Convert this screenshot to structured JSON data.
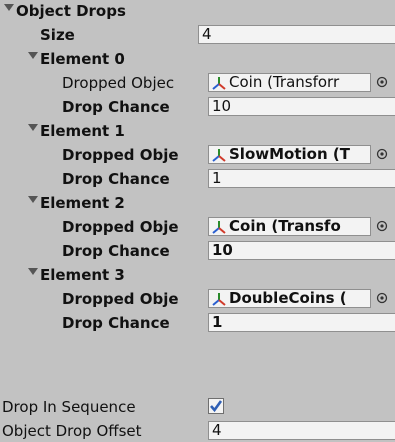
{
  "inspector": {
    "object_drops": {
      "label": "Object Drops",
      "size_label": "Size",
      "size_value": "4",
      "elements": [
        {
          "header": "Element 0",
          "dropped_label": "Dropped Objec",
          "dropped_value": "Coin (Transforr",
          "chance_label": "Drop Chance",
          "chance_value": "10"
        },
        {
          "header": "Element 1",
          "dropped_label": "Dropped Obje",
          "dropped_value": "SlowMotion (T",
          "chance_label": "Drop Chance",
          "chance_value": "1"
        },
        {
          "header": "Element 2",
          "dropped_label": "Dropped Obje",
          "dropped_value": "Coin (Transfo",
          "chance_label": "Drop Chance",
          "chance_value": "10"
        },
        {
          "header": "Element 3",
          "dropped_label": "Dropped Obje",
          "dropped_value": "DoubleCoins (",
          "chance_label": "Drop Chance",
          "chance_value": "1"
        }
      ]
    },
    "drop_in_sequence": {
      "label": "Drop In Sequence",
      "checked": true
    },
    "object_drop_offset": {
      "label": "Object Drop Offset",
      "value": "4"
    }
  },
  "icons": {
    "transform": "transform-icon",
    "picker": "object-picker-icon",
    "foldout": "foldout-arrow-icon",
    "check": "checkmark-icon"
  },
  "colors": {
    "panel_bg": "#c2c2c2",
    "field_bg": "#f3f3f3",
    "checkmark": "#2f5fb5"
  }
}
